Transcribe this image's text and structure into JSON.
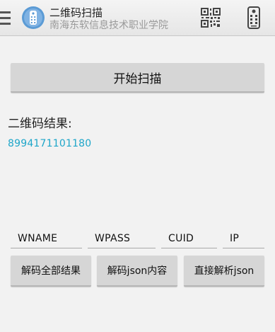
{
  "header": {
    "title": "二维码扫描",
    "subtitle": "南海东软信息技术职业学院"
  },
  "main": {
    "start_scan_label": "开始扫描",
    "result_label": "二维码结果:",
    "result_value": "8994171101180"
  },
  "fields": {
    "wname": "WNAME",
    "wpass": "WPASS",
    "cuid": "CUID",
    "ip": "IP"
  },
  "actions": {
    "decode_all_label": "解码全部结果",
    "decode_json_label": "解码json内容",
    "parse_json_label": "直接解析json"
  },
  "icons": {
    "drawer": "hamburger-menu-icon",
    "app": "remote-control-icon",
    "qr": "qr-code-icon",
    "remote": "remote-control-icon"
  },
  "colors": {
    "accent": "#1ea6c9",
    "app_icon_bg": "#5b9bd5",
    "button_bg": "#d6d6d6"
  }
}
